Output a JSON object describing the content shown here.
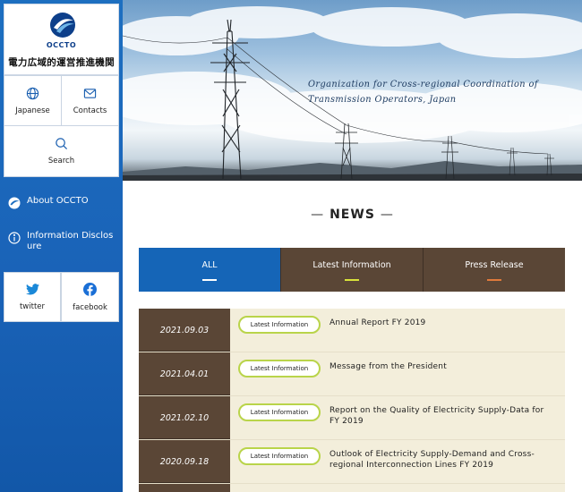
{
  "brand": {
    "name_en": "OCCTO",
    "name_jp": "電力広域的運営推進機関",
    "accent": "#1565b7",
    "brown": "#5a4636"
  },
  "utility": {
    "japanese_label": "Japanese",
    "contacts_label": "Contacts",
    "search_label": "Search"
  },
  "side_nav": {
    "about_label": "About OCCTO",
    "disclosure_label": "Information Disclos\nure"
  },
  "social": {
    "twitter_label": "twitter",
    "facebook_label": "facebook"
  },
  "hero": {
    "tagline_line1": "Organization for Cross-regional Coordination of",
    "tagline_line2": "Transmission Operators, Japan"
  },
  "news": {
    "heading": "NEWS",
    "tabs": [
      {
        "label": "ALL",
        "active": true,
        "bar_color": "#ffffff"
      },
      {
        "label": "Latest Information",
        "active": false,
        "bar_color": "#d9e23a"
      },
      {
        "label": "Press Release",
        "active": false,
        "bar_color": "#e07a3b"
      }
    ],
    "items": [
      {
        "date": "2021.09.03",
        "badge": "Latest Information",
        "title": "Annual Report FY 2019"
      },
      {
        "date": "2021.04.01",
        "badge": "Latest Information",
        "title": "Message from the President"
      },
      {
        "date": "2021.02.10",
        "badge": "Latest Information",
        "title": "Report on the Quality of Electricity Supply-Data for FY 2019"
      },
      {
        "date": "2020.09.18",
        "badge": "Latest Information",
        "title": "Outlook of Electricity Supply-Demand and Cross-regional Interconnection Lines FY 2019"
      }
    ]
  }
}
